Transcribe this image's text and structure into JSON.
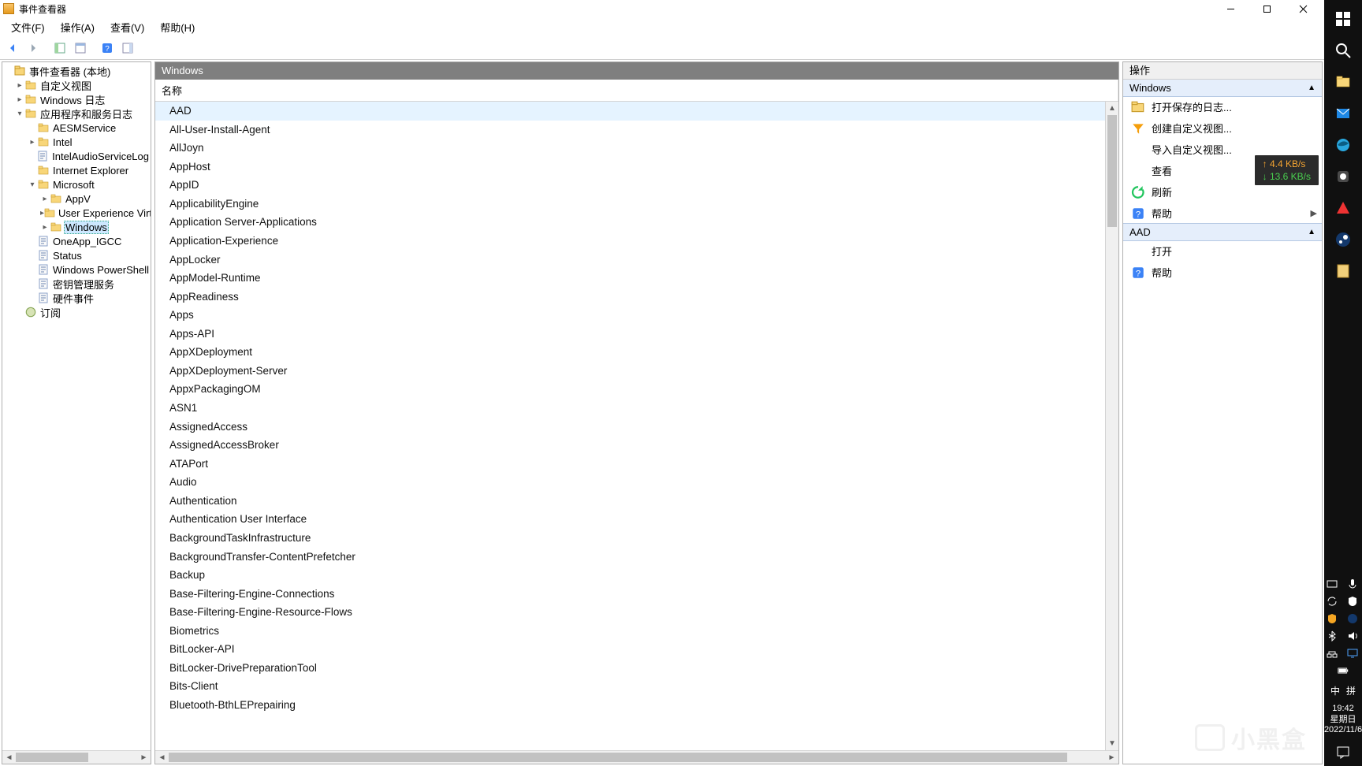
{
  "window": {
    "title": "事件查看器"
  },
  "menubar": [
    "文件(F)",
    "操作(A)",
    "查看(V)",
    "帮助(H)"
  ],
  "tree": [
    {
      "indent": 0,
      "icon": "root",
      "label": "事件查看器 (本地)",
      "exp": ""
    },
    {
      "indent": 1,
      "icon": "folder",
      "label": "自定义视图",
      "exp": "▸"
    },
    {
      "indent": 1,
      "icon": "folder",
      "label": "Windows 日志",
      "exp": "▸"
    },
    {
      "indent": 1,
      "icon": "folder",
      "label": "应用程序和服务日志",
      "exp": "▾"
    },
    {
      "indent": 2,
      "icon": "folder",
      "label": "AESMService",
      "exp": ""
    },
    {
      "indent": 2,
      "icon": "folder",
      "label": "Intel",
      "exp": "▸"
    },
    {
      "indent": 2,
      "icon": "log",
      "label": "IntelAudioServiceLog",
      "exp": ""
    },
    {
      "indent": 2,
      "icon": "folder",
      "label": "Internet Explorer",
      "exp": ""
    },
    {
      "indent": 2,
      "icon": "folder",
      "label": "Microsoft",
      "exp": "▾"
    },
    {
      "indent": 3,
      "icon": "folder",
      "label": "AppV",
      "exp": "▸"
    },
    {
      "indent": 3,
      "icon": "folder",
      "label": "User Experience Virt",
      "exp": "▸"
    },
    {
      "indent": 3,
      "icon": "folder",
      "label": "Windows",
      "exp": "▸",
      "selected": true
    },
    {
      "indent": 2,
      "icon": "log",
      "label": "OneApp_IGCC",
      "exp": ""
    },
    {
      "indent": 2,
      "icon": "log",
      "label": "Status",
      "exp": ""
    },
    {
      "indent": 2,
      "icon": "log",
      "label": "Windows PowerShell",
      "exp": ""
    },
    {
      "indent": 2,
      "icon": "log",
      "label": "密钥管理服务",
      "exp": ""
    },
    {
      "indent": 2,
      "icon": "log",
      "label": "硬件事件",
      "exp": ""
    },
    {
      "indent": 1,
      "icon": "sub",
      "label": "订阅",
      "exp": ""
    }
  ],
  "center": {
    "header": "Windows",
    "column": "名称",
    "rows": [
      "AAD",
      "All-User-Install-Agent",
      "AllJoyn",
      "AppHost",
      "AppID",
      "ApplicabilityEngine",
      "Application Server-Applications",
      "Application-Experience",
      "AppLocker",
      "AppModel-Runtime",
      "AppReadiness",
      "Apps",
      "Apps-API",
      "AppXDeployment",
      "AppXDeployment-Server",
      "AppxPackagingOM",
      "ASN1",
      "AssignedAccess",
      "AssignedAccessBroker",
      "ATAPort",
      "Audio",
      "Authentication",
      "Authentication User Interface",
      "BackgroundTaskInfrastructure",
      "BackgroundTransfer-ContentPrefetcher",
      "Backup",
      "Base-Filtering-Engine-Connections",
      "Base-Filtering-Engine-Resource-Flows",
      "Biometrics",
      "BitLocker-API",
      "BitLocker-DrivePreparationTool",
      "Bits-Client",
      "Bluetooth-BthLEPrepairing"
    ],
    "selected_index": 0
  },
  "actions": {
    "header": "操作",
    "group1": {
      "title": "Windows",
      "items": [
        {
          "icon": "open-folder",
          "label": "打开保存的日志..."
        },
        {
          "icon": "filter",
          "label": "创建自定义视图..."
        },
        {
          "icon": "none",
          "label": "导入自定义视图..."
        },
        {
          "icon": "none",
          "label": "查看",
          "sub": "▶"
        },
        {
          "icon": "refresh",
          "label": "刷新"
        },
        {
          "icon": "help",
          "label": "帮助",
          "sub": "▶"
        }
      ]
    },
    "group2": {
      "title": "AAD",
      "items": [
        {
          "icon": "none",
          "label": "打开"
        },
        {
          "icon": "help",
          "label": "帮助"
        }
      ]
    }
  },
  "net_overlay": {
    "up": "4.4 KB/s",
    "down": "13.6 KB/s"
  },
  "clock": {
    "time": "19:42",
    "weekday": "星期日",
    "date": "2022/11/6"
  },
  "ime": {
    "lang": "中",
    "mode": "拼"
  },
  "watermark": "小黑盒"
}
